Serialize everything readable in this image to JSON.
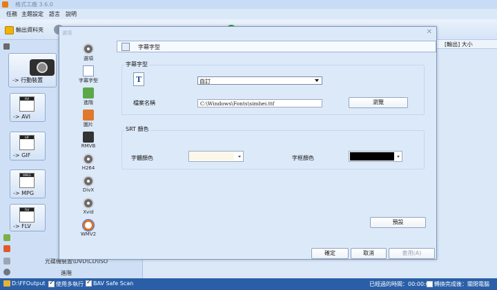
{
  "app": {
    "title": "格式工廠 3.6.0",
    "menu": [
      "任務",
      "主題設定",
      "語言",
      "說明"
    ],
    "toolbar_output_label": "輸出資料夾"
  },
  "left_panel": {
    "big_tile_label": "-> 行動裝置",
    "tiles": [
      {
        "label": "-> AVI",
        "tag": "AVI"
      },
      {
        "label": "-> GIF",
        "tag": "GIF"
      },
      {
        "label": "-> MPG",
        "tag": "MPEG"
      },
      {
        "label": "-> FLV",
        "tag": "FLV"
      }
    ],
    "bottom_text": "光碟機裝置\\DVD\\CD\\ISO",
    "advanced_label": "進階"
  },
  "right_panel": {
    "header": "[輸出] 大小"
  },
  "status_bar": {
    "output_path": "D:\\FFOutput",
    "multithread_label": "使用多執行",
    "safescan_label": "BAV Safe Scan",
    "elapsed_label": "已經過的時間：00:00:00",
    "shutdown_label": "轉換完成後：關閉電腦"
  },
  "dialog": {
    "title": "選項",
    "nav": [
      {
        "label": "選項",
        "icon": "options-icon"
      },
      {
        "label": "字幕字型",
        "icon": "subtitle-font-icon"
      },
      {
        "label": "進階",
        "icon": "advanced-icon"
      },
      {
        "label": "圖片",
        "icon": "picture-icon"
      },
      {
        "label": "RMVB",
        "icon": "rmvb-icon"
      },
      {
        "label": "H264",
        "icon": "h264-icon"
      },
      {
        "label": "DivX",
        "icon": "divx-icon"
      },
      {
        "label": "Xvid",
        "icon": "xvid-icon"
      },
      {
        "label": "WMV2",
        "icon": "wmv2-icon"
      }
    ],
    "panel_header": "字幕字型",
    "font_group_label": "字幕字型",
    "font_select_value": "自訂",
    "file_name_label": "檔案名稱",
    "file_path_value": "C:\\Windows\\Fonts\\simhei.ttf",
    "browse_button": "瀏覽",
    "srt_group_label": "SRT 顏色",
    "text_color_label": "字體顏色",
    "text_color": "#fdf7e9",
    "border_color_label": "字框顏色",
    "border_color": "#000000",
    "default_button": "預設",
    "ok_button": "確定",
    "cancel_button": "取消",
    "apply_button": "套用(A)"
  }
}
